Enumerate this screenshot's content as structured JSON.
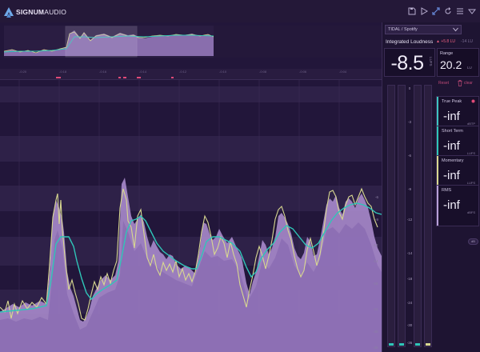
{
  "brand": {
    "name_bold": "SIGNUM",
    "name_light": "AUDIO"
  },
  "toolbar": {
    "icons": [
      "save-icon",
      "play-icon",
      "link-icon",
      "reset-icon",
      "menu-icon",
      "dropdown-icon"
    ]
  },
  "panel": {
    "preset": {
      "selected": "TIDAL / Spotify"
    },
    "integrated": {
      "label": "Integrated Loudness",
      "badge": "▲ +5.8 LU",
      "target": "-14 LU",
      "value": "-8.5",
      "unit": "LUFS"
    },
    "range": {
      "label": "Range",
      "value": "20.2",
      "unit": "LU"
    },
    "reset": {
      "label": "Reset",
      "clear": "clear"
    },
    "meter_scale": [
      "0",
      "-3",
      "-6",
      "-9",
      "-12",
      "-14",
      "-18",
      "-24",
      "-30",
      "-36"
    ],
    "readouts": [
      {
        "label": "True Peak",
        "value": "-inf",
        "unit": "dBTP",
        "color": "#3ec4c0"
      },
      {
        "label": "Short Term",
        "value": "-inf",
        "unit": "LUFS",
        "color": "#2fc6b8"
      },
      {
        "label": "Momentary",
        "value": "-inf",
        "unit": "LUFS",
        "color": "#d8d890"
      },
      {
        "label": "RMS",
        "value": "-inf",
        "unit": "dBFS",
        "color": "#b8a0d8"
      }
    ],
    "rms_toggle": "dB"
  },
  "graph": {
    "timeline_markers": [
      "-0:20",
      "-0:18",
      "-0:16",
      "-0:14",
      "-0:12",
      "-0:10",
      "-0:08",
      "-0:06",
      "-0:04",
      "-0:02"
    ],
    "y_labels": [
      "-6",
      "-9",
      "-12",
      "-14",
      "-18",
      "-24",
      "-30",
      "-36"
    ],
    "colors": {
      "fill": "#a889cc",
      "momentary": "#d8d890",
      "short_term": "#2fc6b8",
      "background": "#22163a"
    }
  }
}
